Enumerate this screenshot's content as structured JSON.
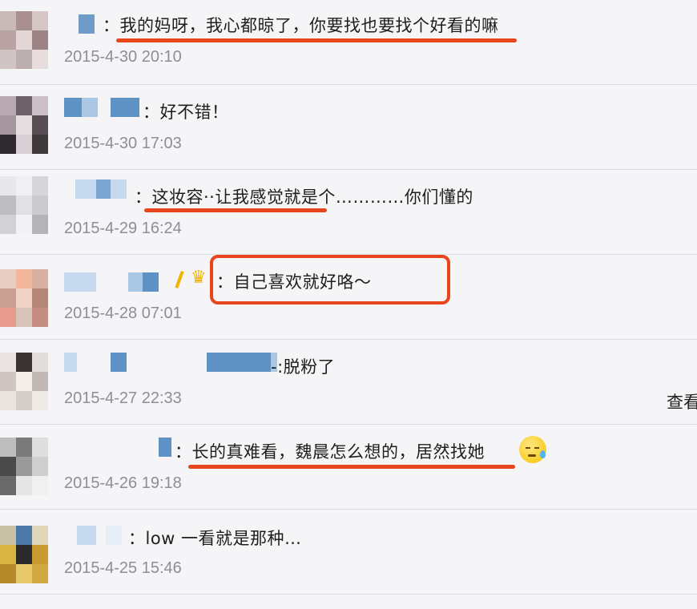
{
  "comments": [
    {
      "text": "：我的妈呀，我心都晾了，你要找也要找个好看的嘛",
      "time": "2015-4-30 20:10"
    },
    {
      "text": "：好不错！",
      "time": "2015-4-30 17:03"
    },
    {
      "text": "：这妆容··让我感觉就是个…………你们懂的",
      "time": "2015-4-29 16:24"
    },
    {
      "text": "：自己喜欢就好咯～",
      "time": "2015-4-28 07:01"
    },
    {
      "text": "-:脱粉了",
      "time": "2015-4-27 22:33"
    },
    {
      "text": "：长的真难看，魏晨怎么想的，居然找她",
      "time": "2015-4-26 19:18"
    },
    {
      "text": "：low 一看就是那种…",
      "time": "2015-4-25 15:46"
    }
  ],
  "view_more_label": "查看",
  "icons": {
    "emoji": "sweat-emoji-icon",
    "crown": "crown-icon"
  },
  "colors": {
    "highlight": "#e8461d",
    "timestamp": "#8e8e93",
    "background": "#f5f5f7"
  }
}
